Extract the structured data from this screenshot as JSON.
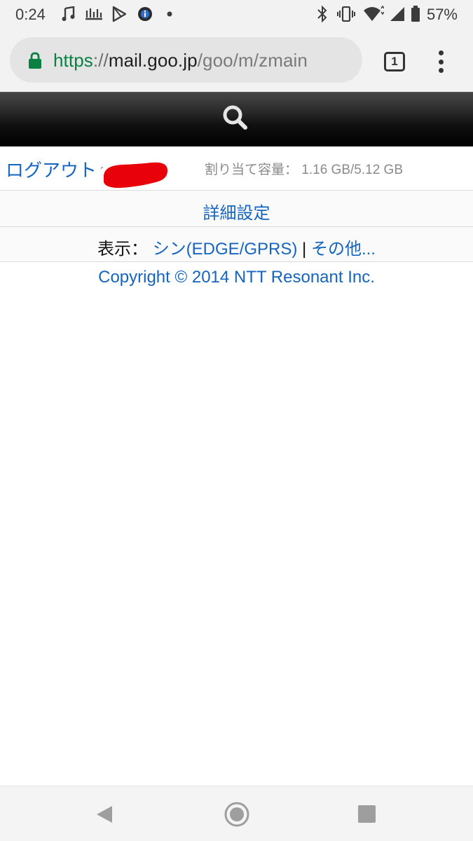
{
  "status_bar": {
    "time": "0:24",
    "battery_percent": "57%",
    "left_icons": [
      "music-note-icon",
      "media-app-icon",
      "play-store-icon",
      "info-icon",
      "dot-icon"
    ],
    "right_icons": [
      "bluetooth-icon",
      "vibrate-icon",
      "wifi-icon",
      "signal-icon",
      "battery-icon"
    ]
  },
  "browser": {
    "url_scheme": "https",
    "url_separator": "://",
    "url_host": "mail.goo.jp",
    "url_path": "/goo/m/zmain",
    "tab_count": "1",
    "secure": true
  },
  "header": {
    "search_icon": "search-icon"
  },
  "account": {
    "logout_label": "ログアウト",
    "quota_label": "割り当て容量：",
    "quota_value": "1.16 GB/5.12 GB"
  },
  "settings": {
    "label": "詳細設定"
  },
  "display": {
    "label": "表示：",
    "current_mode": "シン(EDGE/GPRS)",
    "separator": " | ",
    "other_label": "その他..."
  },
  "footer": {
    "copyright": "Copyright © 2014 NTT Resonant Inc."
  },
  "colors": {
    "link": "#1565c0",
    "secure_green": "#0b8043",
    "redaction": "#e8000a"
  }
}
